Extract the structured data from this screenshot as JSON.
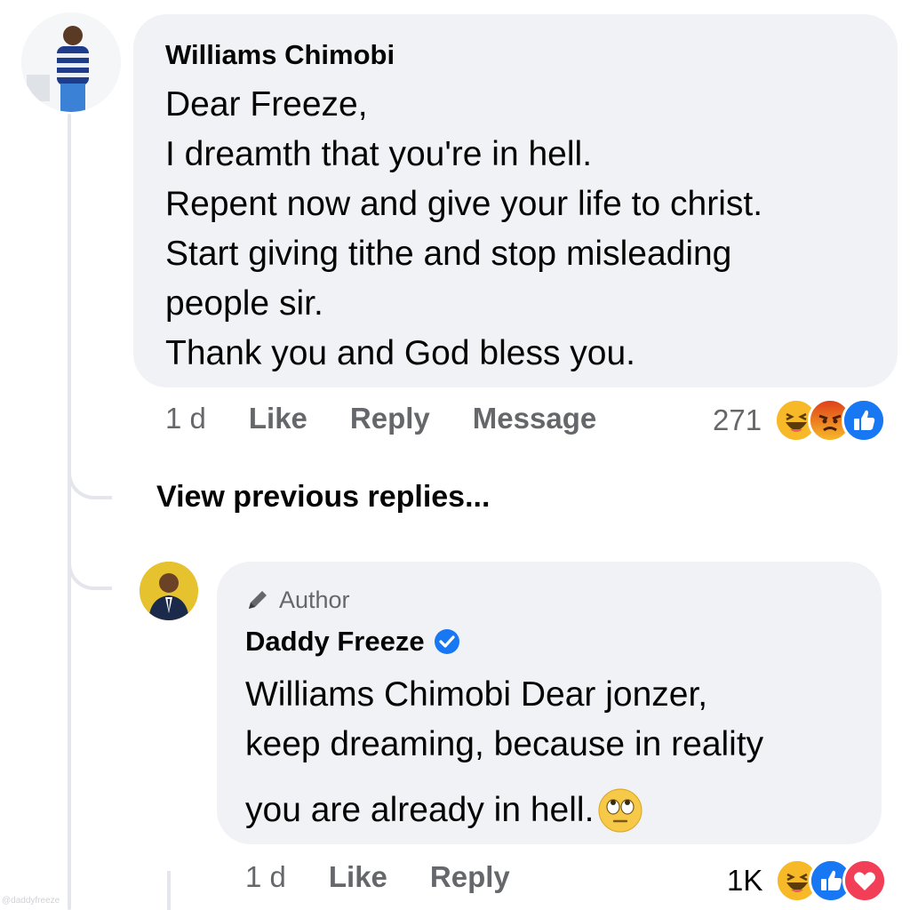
{
  "comment": {
    "author": "Williams Chimobi",
    "lines": [
      "Dear Freeze,",
      "I dreamth that you're in hell.",
      "Repent now and give your life to christ.",
      "Start giving tithe and stop misleading",
      "people sir.",
      "Thank you and God bless you."
    ],
    "time": "1 d",
    "like_label": "Like",
    "reply_label": "Reply",
    "message_label": "Message",
    "reaction_count": "271",
    "reactions": [
      "haha-icon",
      "angry-icon",
      "like-icon"
    ]
  },
  "view_previous": "View previous replies...",
  "reply": {
    "badge": "Author",
    "author": "Daddy Freeze",
    "lines": [
      "Williams Chimobi Dear jonzer,",
      "keep dreaming, because in reality",
      "you are already in hell."
    ],
    "time": "1 d",
    "like_label": "Like",
    "reply_label": "Reply",
    "reaction_count": "1K",
    "reactions": [
      "haha-icon",
      "like-icon",
      "love-icon"
    ]
  },
  "watermark": "@daddyfreeze",
  "colors": {
    "bubble": "#f0f2f5",
    "muted": "#65676b",
    "like_blue": "#1877f2",
    "love_red": "#f33e58",
    "haha_yellow": "#f7b928",
    "angry_orange": "#e9710f"
  }
}
